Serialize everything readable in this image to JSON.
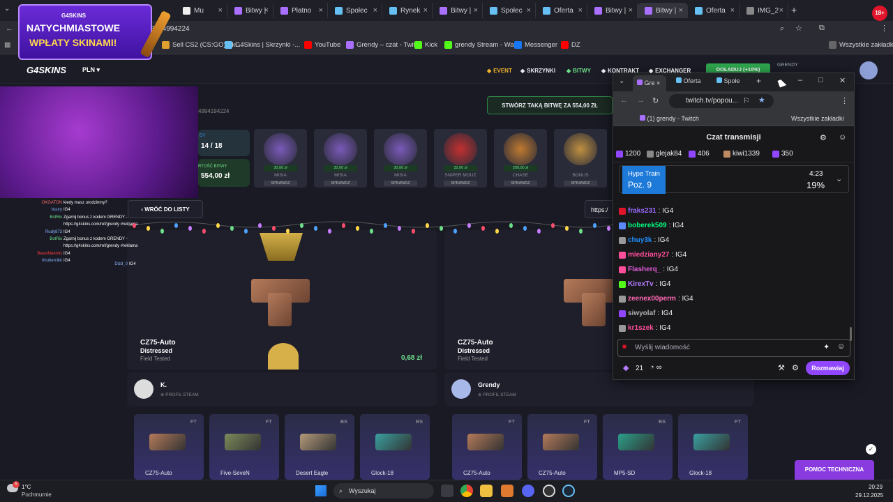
{
  "browser": {
    "tabs": [
      {
        "label": "Mu",
        "color": "#eee"
      },
      {
        "label": "Bitwy |",
        "color": "#a970ff"
      },
      {
        "label": "Płatno",
        "color": "#a970ff"
      },
      {
        "label": "Społec",
        "color": "#66c0f4"
      },
      {
        "label": "Rynek",
        "color": "#66c0f4"
      },
      {
        "label": "Bitwy |",
        "color": "#a970ff"
      },
      {
        "label": "Społec",
        "color": "#66c0f4"
      },
      {
        "label": "Oferta",
        "color": "#66c0f4"
      },
      {
        "label": "Bitwy |",
        "color": "#a970ff"
      },
      {
        "label": "Bitwy |",
        "color": "#a970ff"
      },
      {
        "label": "Oferta",
        "color": "#66c0f4"
      },
      {
        "label": "IMG_2",
        "color": "#888"
      }
    ],
    "url": "8494994224",
    "bookmarks": [
      {
        "label": "Sell CS2 (CS:GO) Ski...",
        "color": "#e0a030"
      },
      {
        "label": "G4Skins | Skrzynki -...",
        "color": "#66c0f4"
      },
      {
        "label": "YouTube",
        "color": "#ff0000"
      },
      {
        "label": "Grendy – czat - Twit...",
        "color": "#a970ff"
      },
      {
        "label": "Kick",
        "color": "#53fc18"
      },
      {
        "label": "grendy Stream - Wa...",
        "color": "#53fc18"
      },
      {
        "label": "Messenger",
        "color": "#1877f2"
      },
      {
        "label": "DZ",
        "color": "#ff0000"
      }
    ],
    "all_bookmarks": "Wszystkie zakładki",
    "recording_badge": "18+"
  },
  "promo": {
    "line1": "NATYCHMIASTOWE",
    "line2": "WPŁATY SKINAMI!",
    "brand": "G4SKINS"
  },
  "site": {
    "logo": "G4SKINS",
    "currency": "PLN",
    "nav": [
      {
        "label": "EVENT",
        "color": "#f0b429"
      },
      {
        "label": "SKRZYNKI",
        "color": "#e8e8ee"
      },
      {
        "label": "BITWY",
        "color": "#6ee08a"
      },
      {
        "label": "KONTRAKT",
        "color": "#e8e8ee"
      },
      {
        "label": "EXCHANGER",
        "color": "#e8e8ee"
      }
    ],
    "deposit_button": "DOŁADUJ (+10%)",
    "user_label": "GRENDY",
    "battle_id": "4994194224",
    "round_label": "DY",
    "round_value": "14 / 18",
    "value_label": "RTOŚĆ BITWY",
    "value": "554,00 zł",
    "create_battle": "STWÓRZ TAKĄ BITWĘ ZA 554,00 ZŁ",
    "back_button": "WRÓĆ DO LISTY",
    "link_partial": "https:/",
    "cases": [
      {
        "price": "30,00 zł",
        "name": "MISIA",
        "btn": "SPRAWDŹ"
      },
      {
        "price": "30,00 zł",
        "name": "MISIA",
        "btn": "SPRAWDŹ"
      },
      {
        "price": "30,00 zł",
        "name": "MISIA",
        "btn": "SPRAWDŹ"
      },
      {
        "price": "32,00 zł",
        "name": "SNIPER MOUZ",
        "btn": "SPRAWDŹ"
      },
      {
        "price": "200,00 zł",
        "name": "CHASE",
        "btn": "SPRAWDŹ"
      },
      {
        "price": "",
        "name": "BONUS",
        "btn": "SPRAWDŹ"
      }
    ],
    "drops": [
      {
        "name": "CZ75-Auto",
        "wear": "Distressed",
        "cond": "Field Tested",
        "price": "0,68 zł",
        "player": "K.",
        "profile": "PROFIL STEAM"
      },
      {
        "name": "CZ75-Auto",
        "wear": "Distressed",
        "cond": "Field Tested",
        "price": "",
        "player": "Grendy",
        "profile": "PROFIL STEAM"
      }
    ],
    "skins_left": [
      {
        "q": "FT",
        "name": "CZ75-Auto",
        "color": "#b47a5a"
      },
      {
        "q": "FT",
        "name": "Five-SeveN",
        "color": "#7c8a5a"
      },
      {
        "q": "BS",
        "name": "Desert Eagle",
        "color": "#b49a7a"
      },
      {
        "q": "BS",
        "name": "Glock-18",
        "color": "#3aa0a0"
      }
    ],
    "skins_right": [
      {
        "q": "FT",
        "name": "CZ75-Auto",
        "color": "#b47a5a"
      },
      {
        "q": "FT",
        "name": "CZ75-Auto",
        "color": "#b47a5a"
      },
      {
        "q": "BS",
        "name": "MP5-SD",
        "color": "#2aa08a"
      },
      {
        "q": "FT",
        "name": "Glock-18",
        "color": "#3aa0a0"
      }
    ],
    "help_button": "POMOC TECHNICZNA"
  },
  "overlay_chat": [
    {
      "user": "OKGATON",
      "msg": "kiedy masz urodzinmy?",
      "color": "#ff6b6b"
    },
    {
      "user": "buury",
      "msg": "IG4",
      "color": "#8ab4ff"
    },
    {
      "user": "BotRix",
      "msg": "Zgarnij bonus z kodem GRENDY -",
      "color": "#6ee08a"
    },
    {
      "user": "",
      "msg": "https://g4skins.com/ref/grendy #reklama",
      "color": "#fff"
    },
    {
      "user": "Rudy873",
      "msg": "IG4",
      "color": "#8ab4ff"
    },
    {
      "user": "BotRix",
      "msg": "Zgarnij bonus z kodem GRENDY -",
      "color": "#6ee08a"
    },
    {
      "user": "",
      "msg": "https://g4skins.com/ref/grendy #reklama",
      "color": "#fff"
    },
    {
      "user": "BeastNeemis",
      "msg": "IG4",
      "color": "#ff3b3b"
    },
    {
      "user": "hhubercikk",
      "msg": "IG4",
      "color": "#8ab4ff"
    },
    {
      "user": "Dizd_0",
      "msg": "IG4",
      "color": "#8ab4ff"
    }
  ],
  "popup": {
    "tabs": [
      "Gre",
      "Oferta",
      "Społe"
    ],
    "url": "twitch.tv/popou...",
    "bookmark": "(1) grendy - Twitch",
    "all_bookmarks": "Wszystkie zakładki",
    "chat_title": "Czat transmisji",
    "leaders": [
      {
        "count": "1200",
        "name": ""
      },
      {
        "count": "",
        "name": "glejak84"
      },
      {
        "count": "406",
        "name": ""
      },
      {
        "count": "",
        "name": "kiwi1339"
      },
      {
        "count": "350",
        "name": ""
      }
    ],
    "hype_title": "Hype Train",
    "hype_level": "Poz. 9",
    "hype_time": "4:23",
    "hype_percent": "19%",
    "messages": [
      {
        "user": "fraks231",
        "msg": ": IG4",
        "color": "#9b6bff"
      },
      {
        "user": "boberek509",
        "msg": ": IG4",
        "color": "#00ff7f"
      },
      {
        "user": "chuy3k",
        "msg": ": IG4",
        "color": "#1e90ff"
      },
      {
        "user": "miedziany27",
        "msg": ": IG4",
        "color": "#ff4f9a"
      },
      {
        "user": "Flasherq_",
        "msg": ": IG4",
        "color": "#e05ad8"
      },
      {
        "user": "KirexTv",
        "msg": ": IG4",
        "color": "#b77bff"
      },
      {
        "user": "zeenex00perm",
        "msg": ": IG4",
        "color": "#ff69b4"
      },
      {
        "user": "siwyolaf",
        "msg": ": IG4",
        "color": "#b0b0b0"
      },
      {
        "user": "kr1szek",
        "msg": ": IG4",
        "color": "#ff4f9a"
      }
    ],
    "input_placeholder": "Wyślij wiadomość",
    "points": "21",
    "infinity": "∞",
    "chat_button": "Rozmawiaj"
  },
  "taskbar": {
    "temp": "1°C",
    "weather": "Pochmurnie",
    "search": "Wyszukaj",
    "time": "20:29",
    "date": "29.12.2025",
    "notif": "5"
  }
}
